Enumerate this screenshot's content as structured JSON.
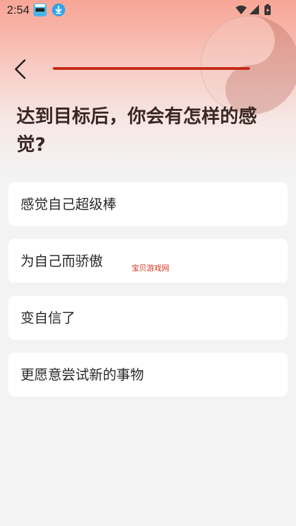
{
  "status_bar": {
    "time": "2:54",
    "icons": [
      "game-app-icon",
      "download-icon",
      "wifi-icon",
      "cellular-signal-icon",
      "battery-charging-icon"
    ]
  },
  "header": {
    "back_icon": "chevron-left-icon",
    "progress_fraction": 1.0,
    "progress_color": "#c62a16"
  },
  "question": {
    "title": "达到目标后，你会有怎样的感觉?"
  },
  "options": [
    {
      "label": "感觉自己超级棒"
    },
    {
      "label": "为自己而骄傲"
    },
    {
      "label": "变自信了"
    },
    {
      "label": "更愿意尝试新的事物"
    }
  ],
  "watermark": {
    "text": "宝贝游戏网"
  },
  "colors": {
    "accent": "#c62a16",
    "card_bg": "#ffffff",
    "page_bg": "#f3f3f3",
    "title_text": "#3a2723"
  }
}
